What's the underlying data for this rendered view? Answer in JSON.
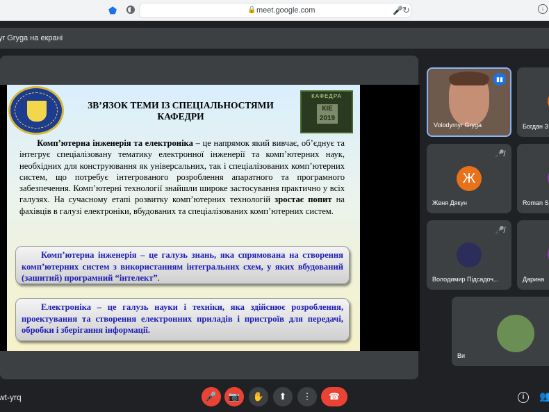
{
  "browser": {
    "url": "meet.google.com"
  },
  "presentation_banner": "yr Gryga на екрані",
  "slide": {
    "title": "ЗВ’ЯЗОК ТЕМИ ІЗ СПЕЦІАЛЬНОСТЯМИ КАФЕДРИ",
    "para_bold1": "Комп’ютерна інженерія та електроніка",
    "para_text1": " – це напрямок який вивчає, об’єднує та інтегрує спеціалізовану тематику електронної інженерії та комп’ютерних наук, необхідних для конструювання як універсальних, так і спеціалізованих комп’ютерних систем, що потребує інтегрованого розроблення апаратного та програмного забезпечення. Комп’ютерні технології знайшли широке застосування практично у всіх галузях. На сучасному етапі розвитку комп’ютерних технологій ",
    "para_bold2": "зростає попит",
    "para_text2": " на фахівців в галузі електроніки, вбудованих та спеціалізованих комп’ютерних систем.",
    "box1": "Комп’ютерна інженерія – це галузь знань, яка спрямована на створення комп’ютерних систем з використанням інтегральних схем, у яких вбудований (зашитий) програмний “інтелект”",
    "box1_end": ".",
    "box2": "Електроніка – це галузь науки і техніки, яка здійснює розроблення, проектування та створення електронних приладів і пристроїв для передачі, обробки і зберігання інформації.",
    "logo_right_label": "КАФЕДРА",
    "logo_right_text": "КІЕ 2019"
  },
  "participants": [
    {
      "name": "Volodymyr Gryga"
    },
    {
      "name": "Богдан З"
    },
    {
      "name": "Женя Дякун",
      "initial": "Ж",
      "color": "#e8711a"
    },
    {
      "name": "Roman S"
    },
    {
      "name": "Володимир Підсадоч..."
    },
    {
      "name": "Дарина"
    },
    {
      "name": "Ви"
    }
  ],
  "meeting_code": "wt-yrq",
  "icons": {
    "muted": "mic-off-icon",
    "mic_off": "mic-off-icon",
    "cam_off": "camera-off-icon",
    "hand": "raise-hand-icon",
    "present": "present-icon",
    "more": "more-vert-icon",
    "end": "end-call-icon",
    "info": "info-icon",
    "people": "people-icon"
  }
}
